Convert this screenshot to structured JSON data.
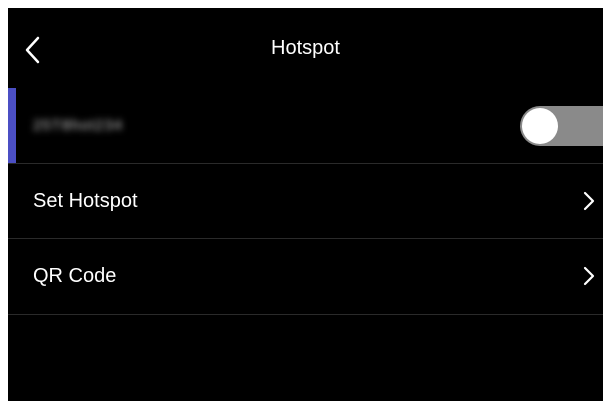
{
  "header": {
    "title": "Hotspot",
    "back_icon": "chevron-left-icon"
  },
  "hotspot": {
    "ssid_label": "25T8hot234",
    "enabled": false,
    "accent_color": "#4b4fc4"
  },
  "menu": {
    "items": [
      {
        "label": "Set Hotspot",
        "icon": "chevron-right-icon"
      },
      {
        "label": "QR Code",
        "icon": "chevron-right-icon"
      }
    ]
  },
  "colors": {
    "background": "#000000",
    "text": "#ffffff",
    "divider": "#2a2a2a",
    "toggle_off": "#8a8a8a"
  }
}
